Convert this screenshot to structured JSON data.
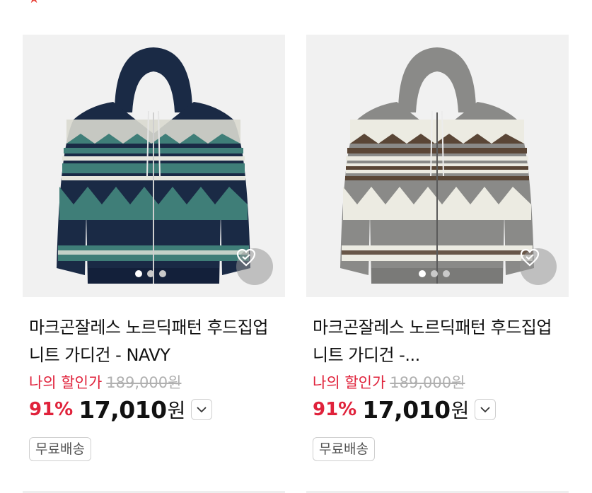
{
  "colors": {
    "accent": "#e0223b",
    "navy": "#1a2a45",
    "gray": "#8a8a88"
  },
  "products": [
    {
      "title": "마크곤잘레스 노르딕패턴 후드집업 니트 가디건 - NAVY",
      "discount_label": "나의 할인가",
      "original_price": "189,000원",
      "discount_rate": "91%",
      "price": "17,010",
      "currency": "원",
      "badge": "무료배송",
      "image_variant": "navy",
      "image_count": 3,
      "active_image": 1
    },
    {
      "title": "마크곤잘레스 노르딕패턴 후드집업 니트 가디건 -...",
      "discount_label": "나의 할인가",
      "original_price": "189,000원",
      "discount_rate": "91%",
      "price": "17,010",
      "currency": "원",
      "badge": "무료배송",
      "image_variant": "gray",
      "image_count": 3,
      "active_image": 1
    }
  ]
}
